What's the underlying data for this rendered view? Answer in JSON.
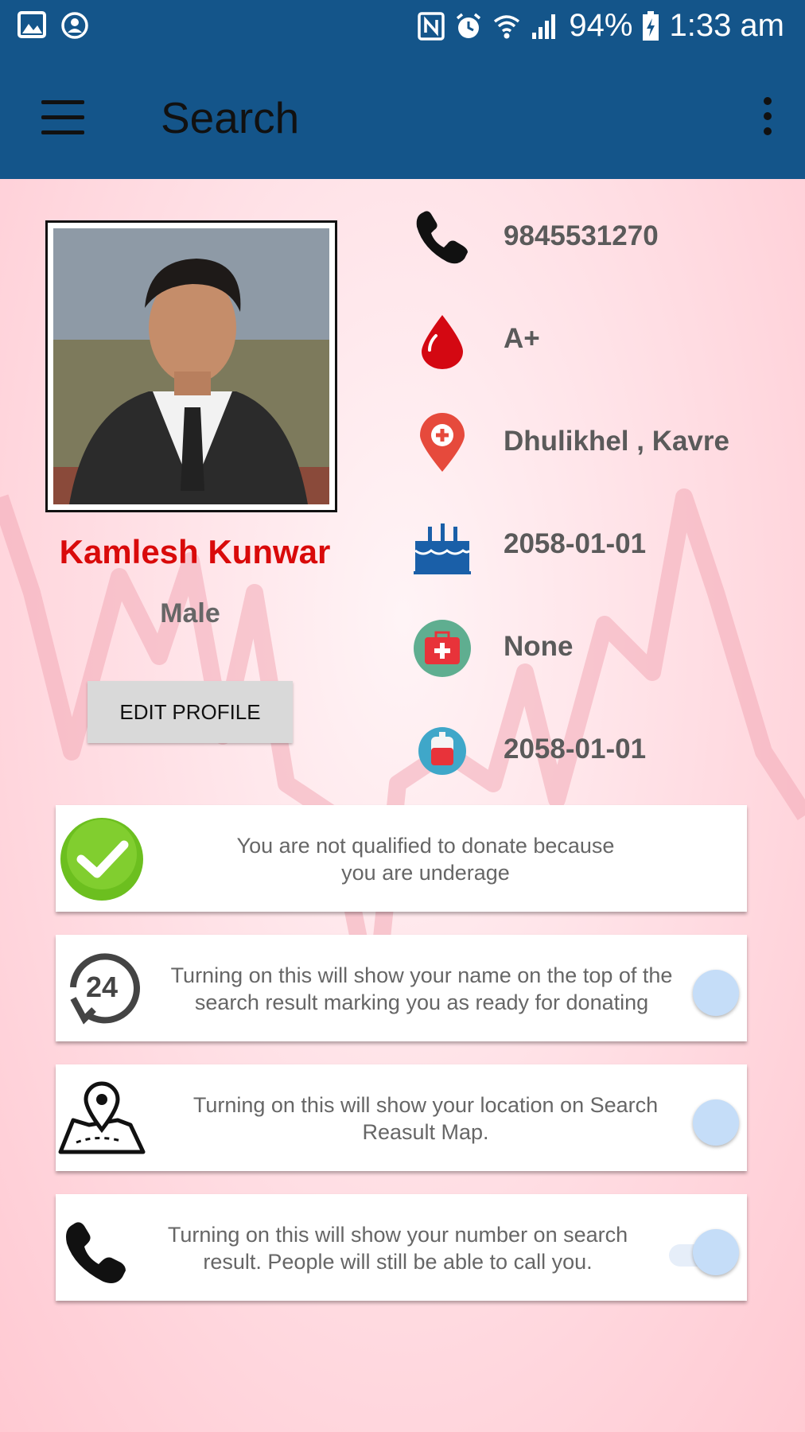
{
  "status_bar": {
    "battery": "94%",
    "time": "1:33 am"
  },
  "app_bar": {
    "title": "Search"
  },
  "profile": {
    "name": "Kamlesh Kunwar",
    "gender": "Male",
    "edit_button": "EDIT PROFILE"
  },
  "details": {
    "phone": "9845531270",
    "blood_group": "A+",
    "address": "Dhulikhel , Kavre",
    "birth_date": "2058-01-01",
    "medical_condition": "None",
    "last_donation": "2058-01-01"
  },
  "cards": {
    "eligibility": {
      "line1": "You are not qualified to donate because",
      "line2": "you are underage"
    },
    "ready": {
      "line1": "Turning on this will show your name on  the top of the",
      "line2": "search result marking you as ready for donating",
      "enabled": false
    },
    "location": {
      "line1": "Turning on this will show your location on Search",
      "line2": "Reasult Map.",
      "enabled": false
    },
    "number": {
      "line1": "Turning on this will show your number on search",
      "line2": "result. People will still be able to call you.",
      "enabled": false
    }
  },
  "colors": {
    "primary": "#14558a",
    "name_red": "#d90a0a",
    "background_pink": "#ffd3da"
  }
}
